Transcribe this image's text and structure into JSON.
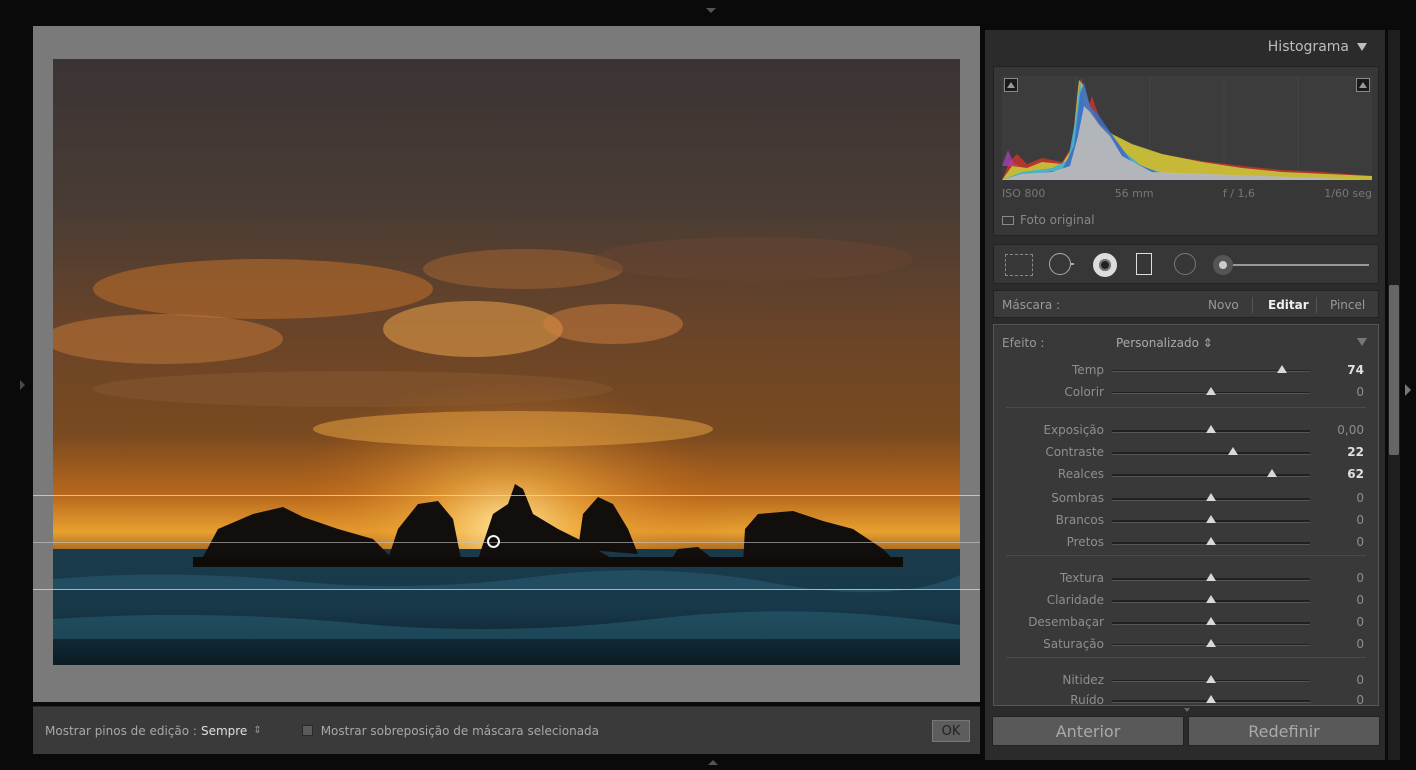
{
  "toolbar": {
    "pins_label": "Mostrar pinos de edição :",
    "pins_value": "Sempre",
    "pins_arrows": "⇕",
    "overlay_label": "Mostrar sobreposição de máscara selecionada",
    "ok_label": "OK"
  },
  "histogram": {
    "title": "Histograma",
    "iso": "ISO 800",
    "focal": "56 mm",
    "aperture": "f / 1,6",
    "shutter": "1/60 seg",
    "original_photo": "Foto original"
  },
  "mask": {
    "label": "Máscara :",
    "new": "Novo",
    "edit": "Editar",
    "brush": "Pincel"
  },
  "effect": {
    "label": "Efeito :",
    "preset": "Personalizado ⇕",
    "sliders": [
      {
        "name": "Temp",
        "value": "74",
        "pos": 0.86,
        "highlight": true
      },
      {
        "name": "Colorir",
        "value": "0",
        "pos": 0.5,
        "highlight": false
      },
      {
        "name": "Exposição",
        "value": "0,00",
        "pos": 0.5,
        "highlight": false
      },
      {
        "name": "Contraste",
        "value": "22",
        "pos": 0.61,
        "highlight": true
      },
      {
        "name": "Realces",
        "value": "62",
        "pos": 0.81,
        "highlight": true
      },
      {
        "name": "Sombras",
        "value": "0",
        "pos": 0.5,
        "highlight": false
      },
      {
        "name": "Brancos",
        "value": "0",
        "pos": 0.5,
        "highlight": false
      },
      {
        "name": "Pretos",
        "value": "0",
        "pos": 0.5,
        "highlight": false
      },
      {
        "name": "Textura",
        "value": "0",
        "pos": 0.5,
        "highlight": false
      },
      {
        "name": "Claridade",
        "value": "0",
        "pos": 0.5,
        "highlight": false
      },
      {
        "name": "Desembaçar",
        "value": "0",
        "pos": 0.5,
        "highlight": false
      },
      {
        "name": "Saturação",
        "value": "0",
        "pos": 0.5,
        "highlight": false
      },
      {
        "name": "Nitidez",
        "value": "0",
        "pos": 0.5,
        "highlight": false
      },
      {
        "name": "Ruído",
        "value": "0",
        "pos": 0.5,
        "highlight": false
      }
    ]
  },
  "buttons": {
    "previous": "Anterior",
    "reset": "Redefinir"
  },
  "colors": {
    "temp_track_left": "#4a4ab8",
    "temp_track_right": "#c8c840",
    "tint_track_left": "#3ab83a",
    "tint_track_right": "#c040c0",
    "sat_track_left": "#3aa0a0",
    "sat_track_right": "#c04040",
    "sharp_track_right": "#b03030"
  }
}
